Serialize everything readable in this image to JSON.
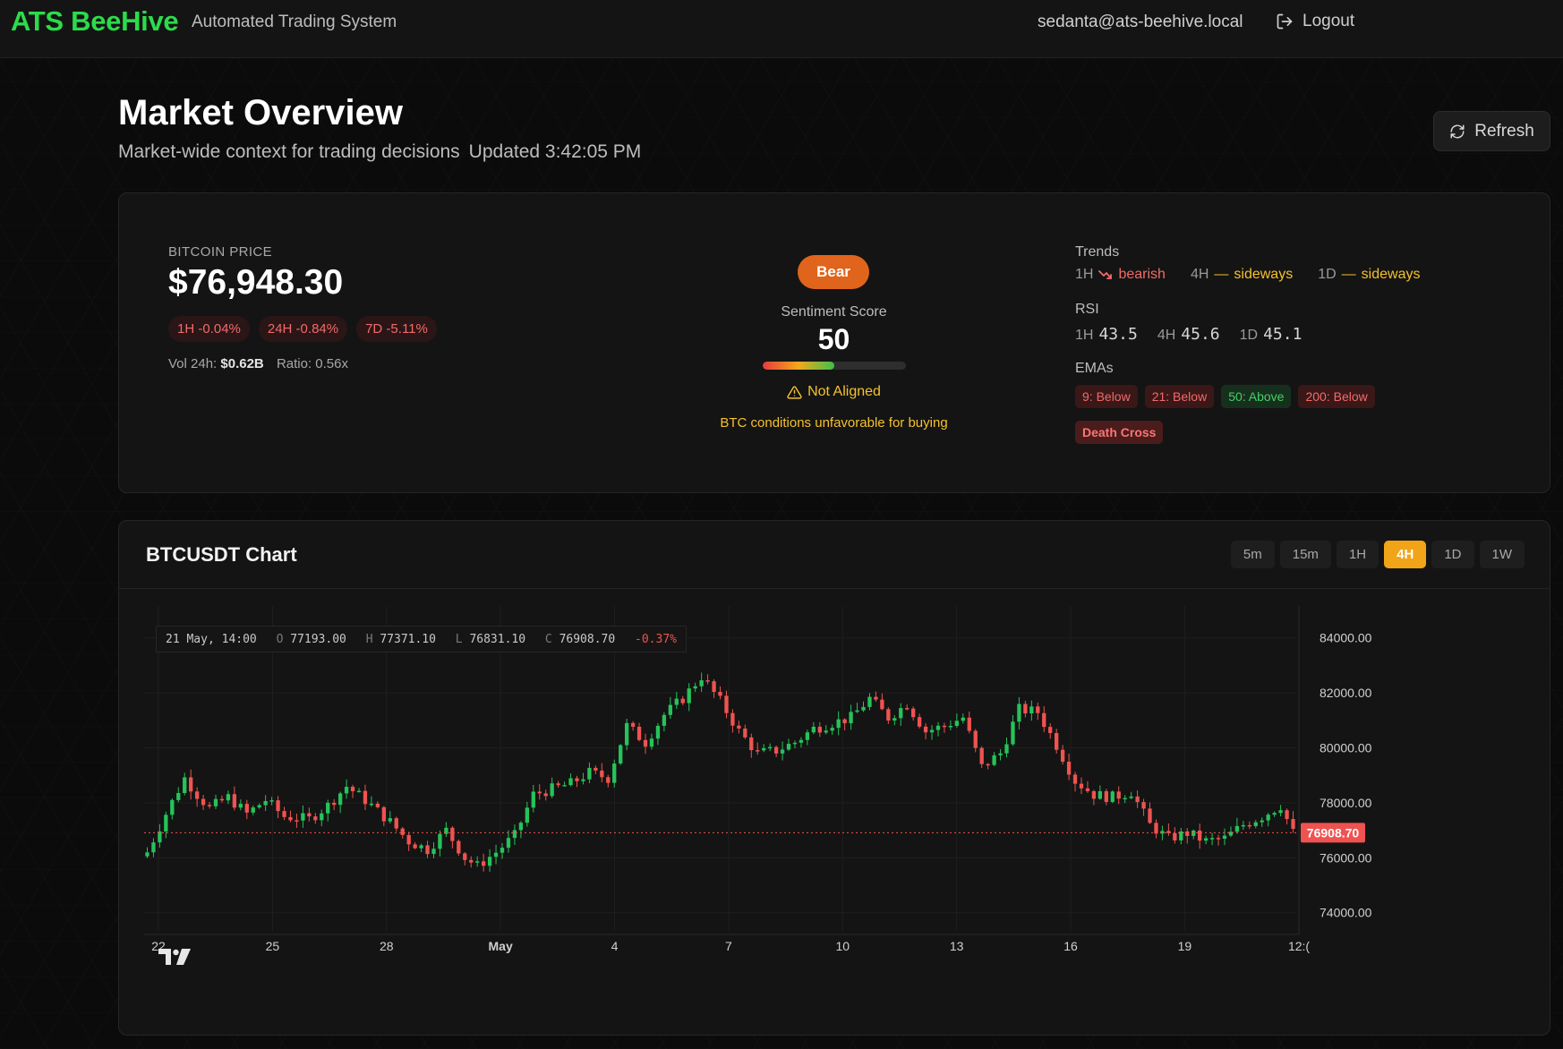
{
  "header": {
    "brand": "ATS BeeHive",
    "subtitle": "Automated Trading System",
    "user_email": "sedanta@ats-beehive.local",
    "logout_label": "Logout"
  },
  "page": {
    "title": "Market Overview",
    "subtitle": "Market-wide context for trading decisions",
    "updated": "Updated 3:42:05 PM",
    "refresh_label": "Refresh"
  },
  "bitcoin": {
    "label": "BITCOIN PRICE",
    "price": "$76,948.30",
    "changes": [
      "1H -0.04%",
      "24H -0.84%",
      "7D -5.11%"
    ],
    "vol_label": "Vol 24h:",
    "vol_value": "$0.62B",
    "ratio_label": "Ratio:",
    "ratio_value": "0.56x"
  },
  "sentiment": {
    "badge": "Bear",
    "score_label": "Sentiment Score",
    "score": "50",
    "score_fraction": 0.5,
    "alignment": "Not Aligned",
    "message": "BTC conditions unfavorable for buying"
  },
  "indicators": {
    "trends_title": "Trends",
    "trends": [
      {
        "tf": "1H",
        "dir": "bearish"
      },
      {
        "tf": "4H",
        "dir": "sideways"
      },
      {
        "tf": "1D",
        "dir": "sideways"
      }
    ],
    "rsi_title": "RSI",
    "rsi": [
      {
        "tf": "1H",
        "value": "43.5"
      },
      {
        "tf": "4H",
        "value": "45.6"
      },
      {
        "tf": "1D",
        "value": "45.1"
      }
    ],
    "emas_title": "EMAs",
    "emas": [
      {
        "label": "9: Below",
        "state": "below"
      },
      {
        "label": "21: Below",
        "state": "below"
      },
      {
        "label": "50: Above",
        "state": "above"
      },
      {
        "label": "200: Below",
        "state": "below"
      }
    ],
    "cross": "Death Cross"
  },
  "chart": {
    "title": "BTCUSDT Chart",
    "timeframes": [
      "5m",
      "15m",
      "1H",
      "4H",
      "1D",
      "1W"
    ],
    "active_timeframe": "4H",
    "ohlc": {
      "date": "21 May, 14:00",
      "o_label": "O",
      "o": "77193.00",
      "h_label": "H",
      "h": "77371.10",
      "l_label": "L",
      "l": "76831.10",
      "c_label": "C",
      "c": "76908.70",
      "change": "-0.37%"
    },
    "last_price": "76908.70"
  },
  "chart_data": {
    "type": "candlestick",
    "symbol": "BTCUSDT",
    "interval": "4H",
    "x_ticks": [
      "22",
      "25",
      "28",
      "May",
      "4",
      "7",
      "10",
      "13",
      "16",
      "19",
      "12:("
    ],
    "y_ticks": [
      "84000.00",
      "82000.00",
      "80000.00",
      "78000.00",
      "76000.00",
      "74000.00"
    ],
    "ylim": [
      73600,
      85000
    ],
    "last_price": 76908.7,
    "close_path": [
      [
        0,
        76200
      ],
      [
        3,
        77600
      ],
      [
        6,
        78900
      ],
      [
        8,
        78300
      ],
      [
        10,
        77800
      ],
      [
        13,
        78200
      ],
      [
        16,
        77600
      ],
      [
        19,
        78100
      ],
      [
        22,
        77500
      ],
      [
        26,
        77400
      ],
      [
        29,
        77900
      ],
      [
        32,
        78600
      ],
      [
        35,
        78100
      ],
      [
        39,
        77300
      ],
      [
        42,
        76600
      ],
      [
        45,
        76300
      ],
      [
        48,
        77000
      ],
      [
        51,
        76000
      ],
      [
        53,
        75700
      ],
      [
        56,
        76200
      ],
      [
        59,
        76800
      ],
      [
        62,
        78300
      ],
      [
        65,
        78500
      ],
      [
        68,
        78700
      ],
      [
        71,
        79100
      ],
      [
        74,
        78900
      ],
      [
        77,
        80800
      ],
      [
        80,
        80200
      ],
      [
        83,
        81200
      ],
      [
        86,
        81800
      ],
      [
        89,
        82600
      ],
      [
        92,
        81700
      ],
      [
        95,
        80600
      ],
      [
        98,
        79800
      ],
      [
        101,
        79900
      ],
      [
        104,
        80200
      ],
      [
        107,
        80700
      ],
      [
        110,
        80900
      ],
      [
        113,
        81100
      ],
      [
        116,
        81800
      ],
      [
        119,
        81100
      ],
      [
        122,
        81600
      ],
      [
        125,
        80600
      ],
      [
        128,
        80800
      ],
      [
        131,
        81100
      ],
      [
        134,
        79300
      ],
      [
        137,
        79800
      ],
      [
        140,
        81400
      ],
      [
        143,
        81300
      ],
      [
        146,
        80100
      ],
      [
        149,
        78800
      ],
      [
        152,
        78300
      ],
      [
        155,
        78200
      ],
      [
        158,
        78400
      ],
      [
        161,
        77200
      ],
      [
        164,
        76700
      ],
      [
        167,
        76900
      ],
      [
        170,
        76600
      ],
      [
        173,
        76700
      ],
      [
        176,
        77200
      ],
      [
        179,
        77500
      ],
      [
        182,
        77900
      ],
      [
        184,
        76909
      ]
    ]
  }
}
